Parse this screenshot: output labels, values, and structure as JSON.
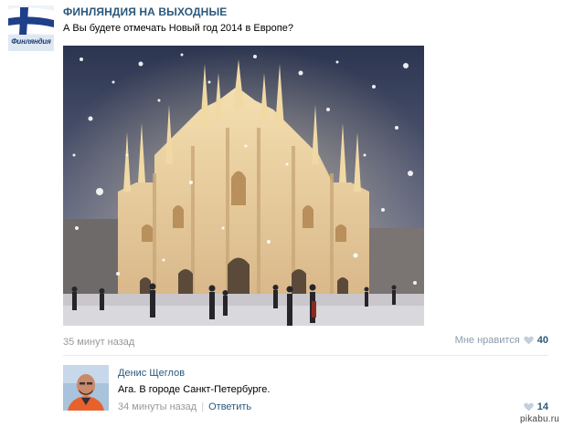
{
  "group": {
    "name": "Финляндия на выходные",
    "avatar_caption": "Финляндия"
  },
  "post": {
    "text": "А Вы будете отмечать Новый год 2014 в Европе?",
    "time": "35 минут назад",
    "like_label": "Мне нравится",
    "like_count": "40"
  },
  "comment": {
    "author": "Денис Щеглов",
    "text": "Ага. В городе Санкт-Петербурге.",
    "time": "34 минуты назад",
    "reply_label": "Ответить",
    "like_count": "14"
  },
  "watermark": "pikabu.ru",
  "icons": {
    "like": "heart-icon",
    "group_avatar": "finnish-flag-icon"
  },
  "colors": {
    "link": "#2b587a",
    "muted": "#999999",
    "like_heart": "#c3cfdc",
    "flag_blue": "#1f3f88"
  }
}
